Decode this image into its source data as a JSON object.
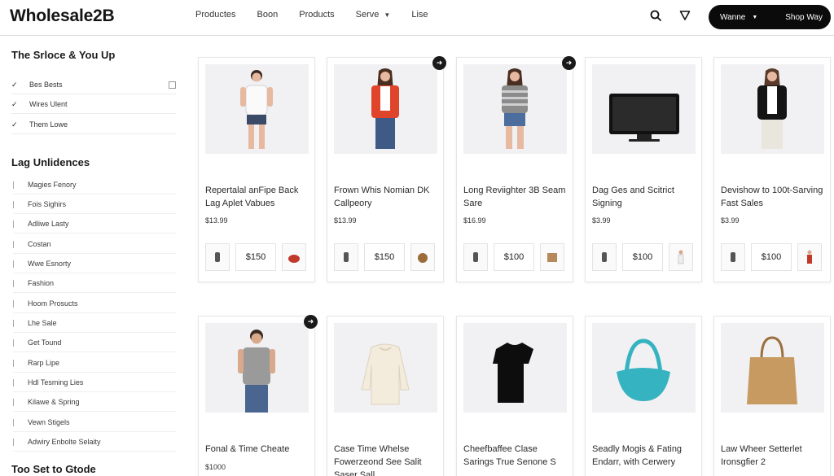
{
  "header": {
    "logo": "Wholesale2B",
    "nav": [
      "Productes",
      "Boon",
      "Products",
      "Serve",
      "Lise"
    ],
    "nav_dropdown_index": 3,
    "select_label": "Wanne",
    "shop_label": "Shop Way",
    "icons": [
      "search-icon",
      "filter-icon"
    ]
  },
  "sidebar": {
    "section1_title": "The Srloce & You Up",
    "checks": [
      "Bes Bests",
      "Wires Ulent",
      "Them Lowe"
    ],
    "section2_title": "Lag Unlidences",
    "categories": [
      "Magies Fenory",
      "Fois Sighirs",
      "Adliwe Lasty",
      "Costan",
      "Wwe Esnorty",
      "Fashion",
      "Hoom Prosucts",
      "Lhe Sale",
      "Get Tound",
      "Rarp Lipe",
      "Hdl Tesming Lies",
      "Kilawe & Spring",
      "Vewn Stigels",
      "Adwiry Enbolte Selaity"
    ],
    "section3_title": "Too Set to Gtode"
  },
  "products": [
    {
      "title": "Repertalal anFipe Back Lag Aplet Vabues",
      "price": "$13.99",
      "thumb_price": "$150",
      "image": "woman-white-tee",
      "fav_icon": false
    },
    {
      "title": "Frown Whis Nomian DK Callpeory",
      "price": "$13.99",
      "thumb_price": "$150",
      "image": "woman-red-jacket",
      "fav_icon": true
    },
    {
      "title": "Long Reviighter 3B Seam Sare",
      "price": "$16.99",
      "thumb_price": "$100",
      "image": "woman-striped-top",
      "fav_icon": true
    },
    {
      "title": "Dag Ges and Scitrict Signing",
      "price": "$3.99",
      "thumb_price": "$100",
      "image": "television",
      "fav_icon": false
    },
    {
      "title": "Devishow to 100t-Sarving Fast Sales",
      "price": "$3.99",
      "thumb_price": "$100",
      "image": "woman-black-blazer",
      "fav_icon": false
    },
    {
      "title": "Fonal & Time Cheate",
      "price": "$1000",
      "image": "man-grey-tee",
      "fav_icon": true
    },
    {
      "title": "Case Time Whelse Fowerzeond See Salit Saser Sall",
      "price": "",
      "image": "cream-sweater",
      "fav_icon": false
    },
    {
      "title": "Cheefbaffee Clase Sarings True Senone S",
      "price": "",
      "image": "black-tshirt",
      "fav_icon": false
    },
    {
      "title": "Seadly Mogis & Fating Endarr, with Cerwery",
      "price": "",
      "image": "teal-handbag",
      "fav_icon": false
    },
    {
      "title": "Law Wheer Setterlet Ironsgfier 2",
      "price": "",
      "image": "tan-tote-bag",
      "fav_icon": false
    }
  ],
  "colors": {
    "accent": "#0b0b0b",
    "red": "#e0452b",
    "teal": "#35b3c0",
    "tan": "#c79a62"
  }
}
